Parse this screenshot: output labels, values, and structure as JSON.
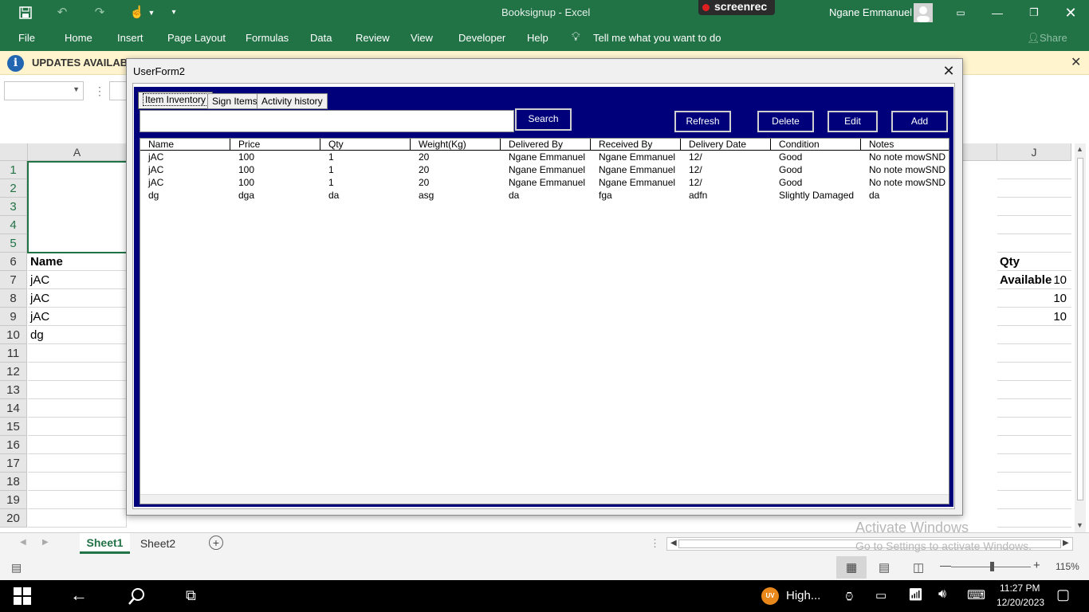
{
  "window": {
    "title": "Booksignup  -  Excel",
    "user": "Ngane Emmanuel",
    "screenrec": "screenrec"
  },
  "ribbon_tabs": [
    "File",
    "Home",
    "Insert",
    "Page Layout",
    "Formulas",
    "Data",
    "Review",
    "View",
    "Developer",
    "Help"
  ],
  "tell_me": "Tell me what you want to do",
  "share": "Share",
  "update_bar": {
    "label": "UPDATES AVAILABLE"
  },
  "grid": {
    "col_a": "A",
    "col_j": "J",
    "rows": [
      "1",
      "2",
      "3",
      "4",
      "5",
      "6",
      "7",
      "8",
      "9",
      "10",
      "11",
      "12",
      "13",
      "14",
      "15",
      "16",
      "17",
      "18",
      "19",
      "20"
    ],
    "a_cells": {
      "6": "Name",
      "7": "jAC",
      "8": "jAC",
      "9": "jAC",
      "10": "dg"
    },
    "j_cells": {
      "6": "Qty Available",
      "7": "10",
      "8": "10",
      "9": "10"
    }
  },
  "sheets": [
    "Sheet1",
    "Sheet2"
  ],
  "watermark": {
    "line1": "Activate Windows",
    "line2": "Go to Settings to activate Windows."
  },
  "status": {
    "zoom": "115%"
  },
  "taskbar": {
    "weather": "High...",
    "time": "11:27 PM",
    "date": "12/20/2023",
    "badge": "UV"
  },
  "userform": {
    "title": "UserForm2",
    "tabs": [
      "Item Inventory",
      "Sign Items",
      "Activity history"
    ],
    "search_label": "Search",
    "buttons": {
      "refresh": "Refresh",
      "delete": "Delete",
      "edit": "Edit",
      "add": "Add"
    },
    "columns": [
      "Name",
      "Price",
      "Qty",
      "Weight(Kg)",
      "Delivered By",
      "Received By",
      "Delivery Date",
      "Condition",
      "Notes"
    ],
    "rows": [
      [
        "jAC",
        "100",
        "1",
        "20",
        "Ngane Emmanuel",
        "Ngane Emmanuel",
        "12/",
        "Good",
        "No note mowSNDI"
      ],
      [
        "jAC",
        "100",
        "1",
        "20",
        "Ngane Emmanuel",
        "Ngane Emmanuel",
        "12/",
        "Good",
        "No note mowSNDI"
      ],
      [
        "jAC",
        "100",
        "1",
        "20",
        "Ngane Emmanuel",
        "Ngane Emmanuel",
        "12/",
        "Good",
        "No note mowSNDI"
      ],
      [
        "dg",
        "dga",
        "da",
        "asg",
        "da",
        "fga",
        "adfn",
        "Slightly Damaged",
        "da"
      ]
    ]
  }
}
